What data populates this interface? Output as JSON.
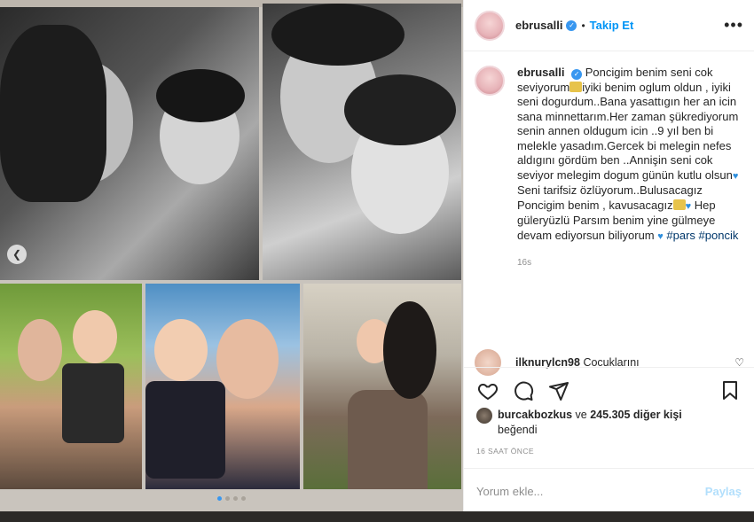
{
  "post": {
    "username": "ebrusalli",
    "follow_label": "Takip Et",
    "more_label": "•••",
    "caption_username": "ebrusalli",
    "caption_lines": [
      "Poncigim benim seni cok",
      "seviyorum",
      "iyiki benim oglum oldun",
      ", iyiki seni dogurdum..Bana yasattıgın",
      "her an icin sana minnettarım.Her",
      "zaman şükrediyorum senin annen",
      "oldugum icin ..9 yıl ben bi melekle",
      "yasadım.Gercek bi melegin nefes",
      "aldıgını gördüm ben ..Annişin seni",
      "cok seviyor melegim dogum günün",
      "kutlu olsun",
      "Seni tarifsiz",
      "özlüyorum..Bulusacagız Poncigim",
      "benim , kavusacagız",
      "Hep",
      "güleryüzlü Parsım benim yine",
      "gülmeye devam ediyorsun biliyorum",
      "#pars #poncik"
    ],
    "caption_time": "16s",
    "comment": {
      "username": "ilknurylcn98",
      "text": "Cocuklarını"
    },
    "likes": {
      "liker": "burcakbozkus",
      "connector": "ve",
      "others": "245.305 diğer kişi",
      "suffix": "beğendi"
    },
    "date": "16 SAAT ÖNCE",
    "comment_placeholder": "Yorum ekle...",
    "share_label": "Paylaş"
  },
  "colors": {
    "accent": "#0095f6",
    "verified": "#3897f0",
    "heart_emoji": "#2f8fdd",
    "share_disabled": "#b2dffc"
  },
  "icons": {
    "like": "heart-outline-icon",
    "comment": "speech-bubble-icon",
    "share": "paper-plane-icon",
    "save": "bookmark-icon",
    "prev": "chevron-left-icon"
  }
}
